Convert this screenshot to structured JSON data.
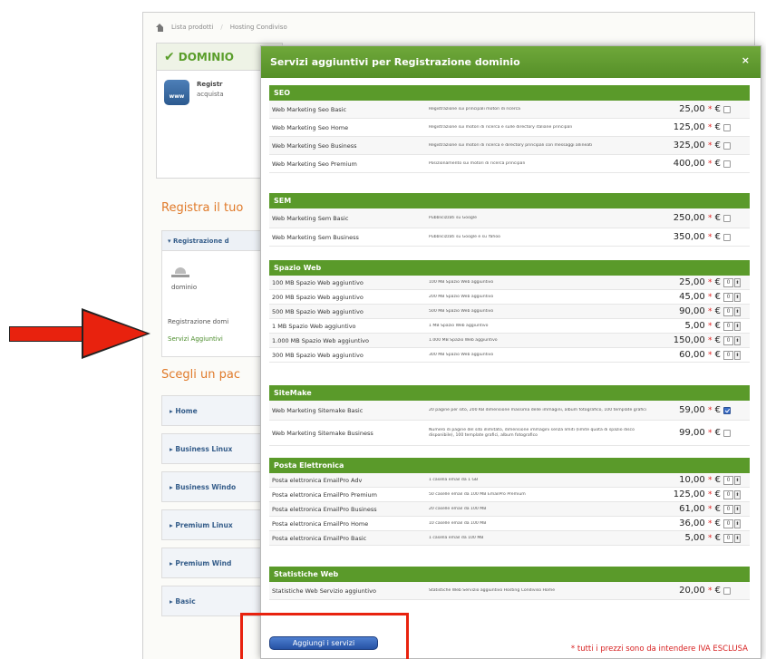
{
  "breadcrumb": {
    "item1": "Lista prodotti",
    "item2": "Hosting Condiviso"
  },
  "domain_box": {
    "title": "DOMINIO",
    "icon_text": "www",
    "line1": "Registr",
    "line2": "acquista"
  },
  "left": {
    "register_title": "Registra il tuo",
    "panel_header": "▾ Registrazione d",
    "icon_label": "dominio",
    "row1": "Registrazione domi",
    "row2": "Servizi Aggiuntivi",
    "packages_title": "Scegli un pac",
    "packages": [
      "▸ Home",
      "▸ Business Linux",
      "▸ Business Windo",
      "▸ Premium Linux",
      "▸ Premium Wind",
      "▸ Basic"
    ]
  },
  "modal": {
    "title": "Servizi aggiuntivi per Registrazione dominio",
    "close": "×",
    "currency": "€",
    "star": "*",
    "categories": [
      {
        "name": "SEO",
        "rows": [
          {
            "name": "Web Marketing Seo Basic",
            "desc": "Registrazione sui principali motori di ricerca",
            "price": "25,00",
            "control": "checkbox",
            "checked": false
          },
          {
            "name": "Web Marketing Seo Home",
            "desc": "Registrazione sui motori di ricerca e sulle directory italiane principali",
            "price": "125,00",
            "control": "checkbox",
            "checked": false
          },
          {
            "name": "Web Marketing Seo Business",
            "desc": "Registrazione sui motori di ricerca e directory principali con messaggi allineati",
            "price": "325,00",
            "control": "checkbox",
            "checked": false
          },
          {
            "name": "Web Marketing Seo Premium",
            "desc": "Posizionamento sui motori di ricerca principali",
            "price": "400,00",
            "control": "checkbox",
            "checked": false
          }
        ]
      },
      {
        "name": "SEM",
        "rows": [
          {
            "name": "Web Marketing Sem Basic",
            "desc": "Pubblicizzati su Google",
            "price": "250,00",
            "control": "checkbox",
            "checked": false
          },
          {
            "name": "Web Marketing Sem Business",
            "desc": "Pubblicizzati su Google e su Yahoo",
            "price": "350,00",
            "control": "checkbox",
            "checked": false
          }
        ]
      },
      {
        "name": "Spazio Web",
        "rows": [
          {
            "name": "100 MB Spazio Web aggiuntivo",
            "desc": "100 MB Spazio Web aggiuntivo",
            "price": "25,00",
            "control": "qty",
            "qty": "0"
          },
          {
            "name": "200 MB Spazio Web aggiuntivo",
            "desc": "200 MB Spazio Web aggiuntivo",
            "price": "45,00",
            "control": "qty",
            "qty": "0"
          },
          {
            "name": "500 MB Spazio Web aggiuntivo",
            "desc": "500 MB Spazio Web aggiuntivo",
            "price": "90,00",
            "control": "qty",
            "qty": "0"
          },
          {
            "name": "1 MB Spazio Web aggiuntivo",
            "desc": "1 MB Spazio Web aggiuntivo",
            "price": "5,00",
            "control": "qty",
            "qty": "0"
          },
          {
            "name": "1.000 MB Spazio Web aggiuntivo",
            "desc": "1.000 MB Spazio Web aggiuntivo",
            "price": "150,00",
            "control": "qty",
            "qty": "0"
          },
          {
            "name": "300 MB Spazio Web aggiuntivo",
            "desc": "300 MB Spazio Web aggiuntivo",
            "price": "60,00",
            "control": "qty",
            "qty": "0"
          }
        ]
      },
      {
        "name": "SiteMake",
        "rows": [
          {
            "name": "Web Marketing Sitemake Basic",
            "desc": "20 pagine per sito, 200 KB dimensione massima delle immagini, album fotografico, 100 template grafici",
            "price": "59,00",
            "control": "checkbox",
            "checked": true
          },
          {
            "name": "Web Marketing Sitemake Business",
            "desc": "Numero di pagine del sito illimitato, dimensione immagini senza limiti (limite quota di spazio disco disponibile), 100 template grafici, album fotografico",
            "price": "99,00",
            "control": "checkbox",
            "checked": false
          }
        ]
      },
      {
        "name": "Posta Elettronica",
        "rows": [
          {
            "name": "Posta elettronica EmailPro Adv",
            "desc": "1 casella email da 1 GB",
            "price": "10,00",
            "control": "qty",
            "qty": "0"
          },
          {
            "name": "Posta elettronica EmailPro Premium",
            "desc": "50 caselle email da 100 MB EmailPro Premium",
            "price": "125,00",
            "control": "qty",
            "qty": "0"
          },
          {
            "name": "Posta elettronica EmailPro Business",
            "desc": "20 caselle email da 100 MB",
            "price": "61,00",
            "control": "qty",
            "qty": "0"
          },
          {
            "name": "Posta elettronica EmailPro Home",
            "desc": "10 caselle email da 100 MB",
            "price": "36,00",
            "control": "qty",
            "qty": "0"
          },
          {
            "name": "Posta elettronica EmailPro Basic",
            "desc": "1 casella email da 100 MB",
            "price": "5,00",
            "control": "qty",
            "qty": "0"
          }
        ]
      },
      {
        "name": "Statistiche Web",
        "rows": [
          {
            "name": "Statistiche Web Servizio aggiuntivo",
            "desc": "Statistiche Web Servizio aggiuntivo Hosting Condiviso Home",
            "price": "20,00",
            "control": "checkbox",
            "checked": false
          }
        ]
      }
    ],
    "footnote": "* tutti i prezzi sono da intendere IVA ESCLUSA",
    "add_button": "Aggiungi i servizi"
  },
  "colors": {
    "green": "#5a9a2a",
    "accent_orange": "#e07a2a",
    "annotation_red": "#e8220e",
    "price_star": "#e02020"
  }
}
